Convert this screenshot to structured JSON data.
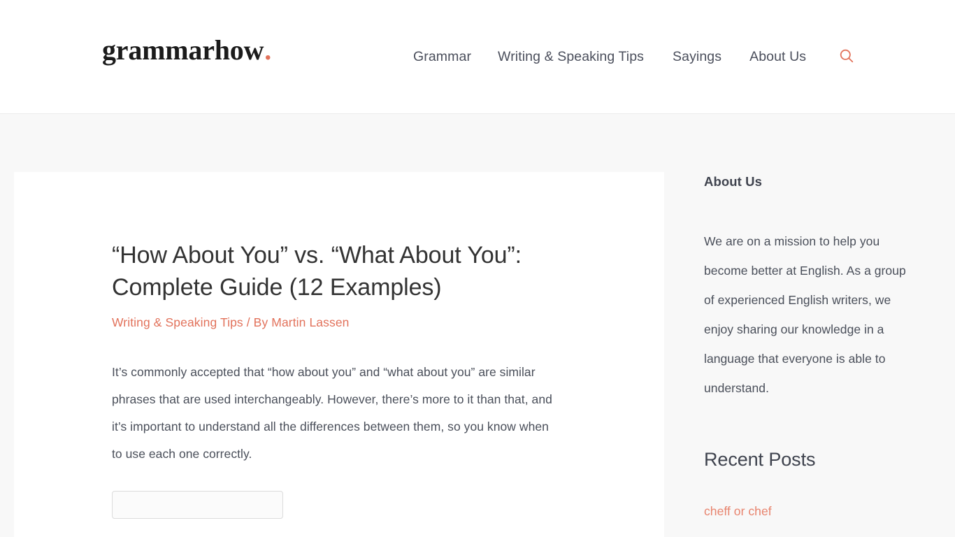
{
  "header": {
    "brand": {
      "word": "grammarhow",
      "dot": "."
    },
    "nav": [
      {
        "label": "Grammar"
      },
      {
        "label": "Writing & Speaking Tips"
      },
      {
        "label": "Sayings"
      },
      {
        "label": "About Us"
      }
    ],
    "search_icon": "search-icon"
  },
  "article": {
    "title": "“How About You” vs. “What About You”: Complete Guide (12 Examples)",
    "category": "Writing & Speaking Tips",
    "byline_separator": "/",
    "byline_prefix": "By",
    "author": "Martin Lassen",
    "paragraph": "It’s commonly accepted that “how about you” and “what about you” are similar phrases that are used interchangeably. However, there’s more to it than that, and it’s important to understand all the differences between them, so you know when to use each one correctly."
  },
  "sidebar": {
    "about": {
      "title": "About Us",
      "text": "We are on a mission to help you become better at English. As a group of experienced English writers, we enjoy sharing our knowledge in a language that everyone is able to understand."
    },
    "recent": {
      "title": "Recent Posts",
      "posts": [
        {
          "label": "cheff or chef"
        }
      ]
    }
  },
  "colors": {
    "accent": "#e2725b",
    "link": "#e8846e",
    "text": "#4a4f5a",
    "heading": "#333333",
    "page_bg": "#f8f8f8",
    "card_bg": "#ffffff"
  }
}
